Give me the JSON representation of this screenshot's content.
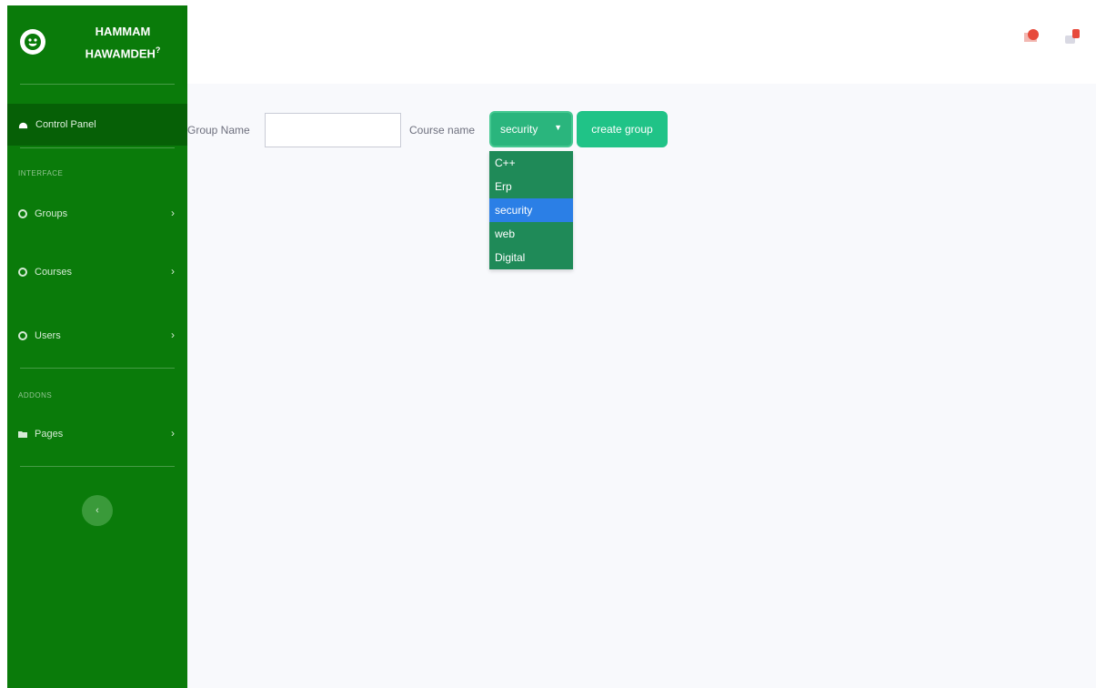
{
  "brand": {
    "name": "HAMMAM HAWAMDEH",
    "suffix": "?"
  },
  "sidebar": {
    "dashboard_label": "Control Panel",
    "section_interface": "INTERFACE",
    "items": [
      {
        "label": "Groups"
      },
      {
        "label": "Courses"
      },
      {
        "label": "Users"
      }
    ],
    "section_addons": "ADDONS",
    "pages_label": "Pages",
    "toggle_symbol": "‹"
  },
  "form": {
    "group_name_label": "Group Name",
    "group_name_value": "",
    "course_name_label": "Course name",
    "course_selected": "security",
    "course_options": [
      "C++",
      "Erp",
      "security",
      "web",
      "Digital"
    ],
    "create_button_label": "create group"
  },
  "colors": {
    "sidebar": "#0a7b0a",
    "accent": "#20c387",
    "selected_option": "#2b7fe6",
    "alert": "#e74a3b"
  },
  "icons": [
    "user-avatar-icon",
    "tachometer-icon",
    "cog-icon",
    "folder-icon",
    "chevron-right-icon",
    "bell-icon",
    "envelope-icon"
  ]
}
